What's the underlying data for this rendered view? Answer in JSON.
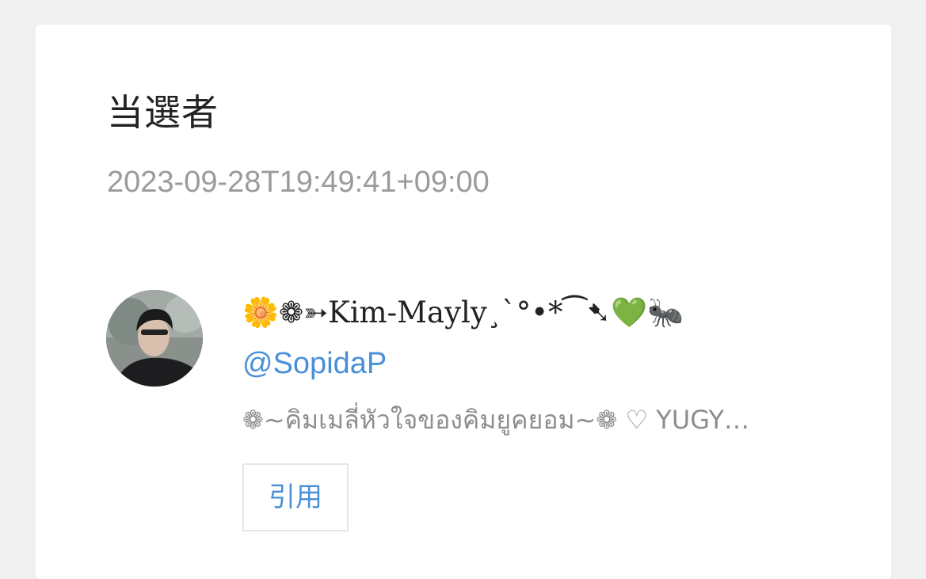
{
  "header": {
    "title": "当選者",
    "timestamp": "2023-09-28T19:49:41+09:00"
  },
  "winner": {
    "avatar_icon": "user-avatar-photo",
    "display_name": "🌼❁➳Kim-Mayly¸`°•*⁀➷💚🐜",
    "handle": "@SopidaP",
    "bio": "❁~คิมเมลี่หัวใจของคิมยูคยอม~❁ ♡ YUGY…"
  },
  "actions": {
    "quote_label": "引用"
  },
  "colors": {
    "link": "#4a90d9",
    "muted": "#9b9b9b",
    "background": "#f0f0f0",
    "card": "#ffffff"
  }
}
